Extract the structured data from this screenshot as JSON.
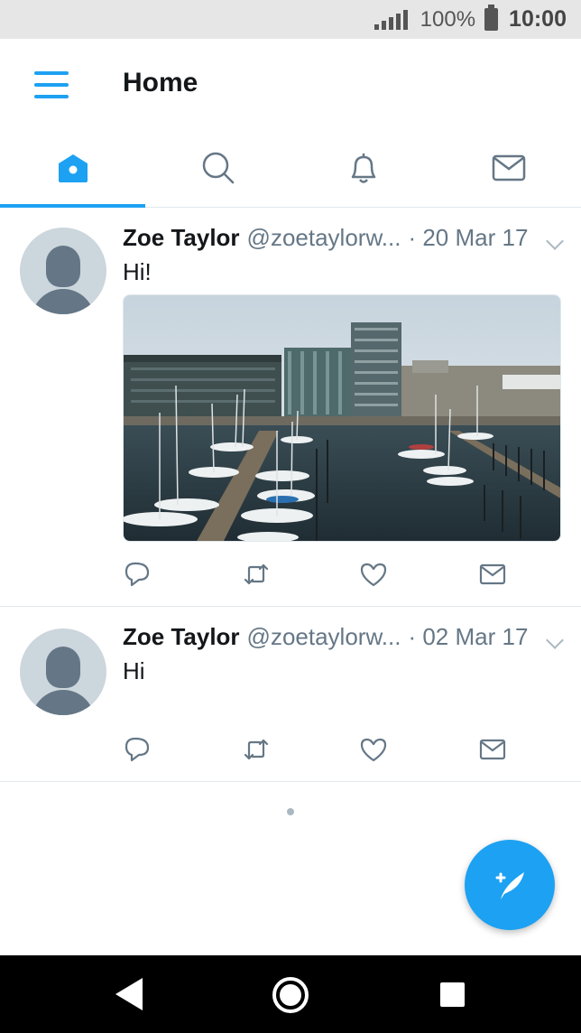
{
  "status_bar": {
    "battery_percent": "100%",
    "time": "10:00"
  },
  "header": {
    "title": "Home"
  },
  "tabs": [
    {
      "name": "home",
      "icon": "home-icon",
      "active": true
    },
    {
      "name": "search",
      "icon": "search-icon",
      "active": false
    },
    {
      "name": "notifications",
      "icon": "bell-icon",
      "active": false
    },
    {
      "name": "messages",
      "icon": "envelope-icon",
      "active": false
    }
  ],
  "tweets": [
    {
      "name": "Zoe Taylor",
      "handle": "@zoetaylorw...",
      "date": "· 20 Mar 17",
      "text": "Hi!",
      "has_image": true,
      "image_description_icon": "harbor-photo"
    },
    {
      "name": "Zoe Taylor",
      "handle": "@zoetaylorw...",
      "date": "· 02 Mar 17",
      "text": "Hi",
      "has_image": false
    }
  ],
  "colors": {
    "accent": "#1da1f2",
    "text_primary": "#14171a",
    "text_secondary": "#657786",
    "icon_gray": "#657786",
    "divider": "#e1e8ed"
  }
}
